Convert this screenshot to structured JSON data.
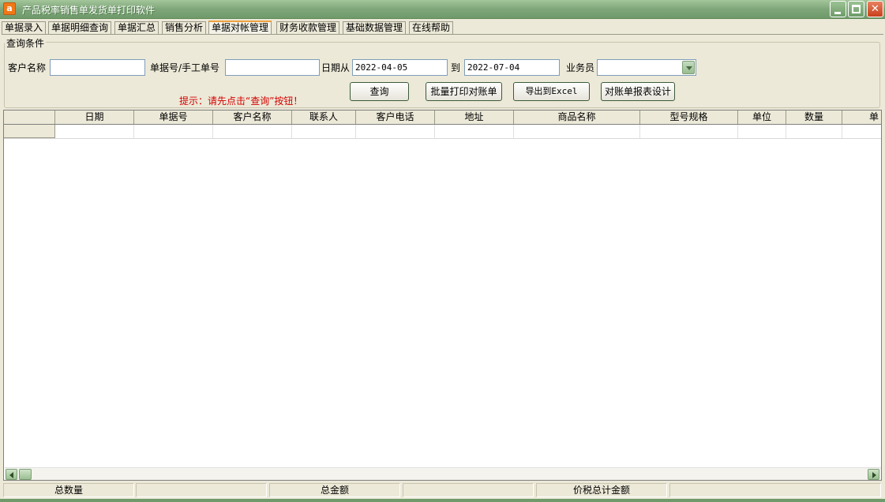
{
  "window": {
    "title": "产品税率销售单发货单打印软件",
    "icon_letter": "a",
    "minimize_label": "",
    "maximize_label": "",
    "close_label": "✕"
  },
  "tabs": [
    {
      "label": "单据录入"
    },
    {
      "label": "单据明细查询"
    },
    {
      "label": "单据汇总"
    },
    {
      "label": "销售分析"
    },
    {
      "label": "单据对帐管理",
      "active": true
    },
    {
      "label": "财务收款管理"
    },
    {
      "label": "基础数据管理"
    },
    {
      "label": "在线帮助"
    }
  ],
  "query": {
    "group_title": "查询条件",
    "customer_label": "客户名称",
    "customer_value": "",
    "docno_label": "单据号/手工单号",
    "docno_value": "",
    "date_from_label": "日期从",
    "date_from_value": "2022-04-05",
    "date_to_label": "到",
    "date_to_value": "2022-07-04",
    "salesman_label": "业务员",
    "salesman_value": "",
    "hint": "提示：请先点击“查询”按钮！",
    "buttons": {
      "query": "查询",
      "batch_print": "批量打印对账单",
      "export_excel": "导出到Excel",
      "report_design": "对账单报表设计"
    }
  },
  "grid": {
    "columns": [
      "日期",
      "单据号",
      "客户名称",
      "联系人",
      "客户电话",
      "地址",
      "商品名称",
      "型号规格",
      "单位",
      "数量",
      "单"
    ]
  },
  "status": {
    "total_qty_label": "总数量",
    "total_qty_value": "",
    "total_amount_label": "总金额",
    "total_amount_value": "",
    "tax_total_label": "价税总计金额",
    "tax_total_value": ""
  },
  "colors": {
    "titlebar": "#7fa67a",
    "hint": "#d40000",
    "background": "#ece9d8"
  }
}
